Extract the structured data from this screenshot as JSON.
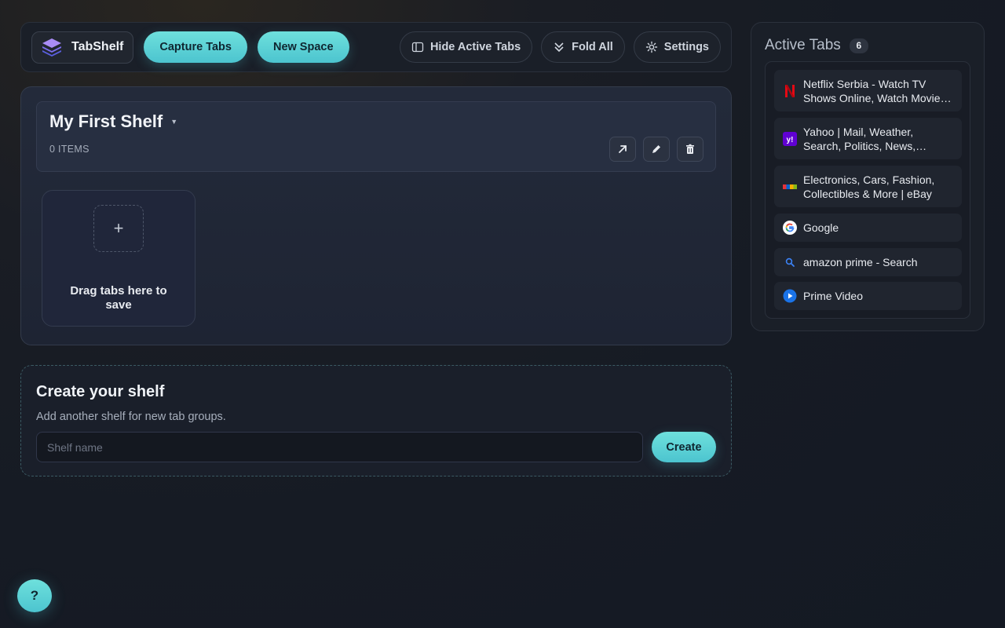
{
  "toolbar": {
    "brand_name": "TabShelf",
    "capture_label": "Capture Tabs",
    "new_space_label": "New Space",
    "hide_active_label": "Hide Active Tabs",
    "fold_all_label": "Fold All",
    "settings_label": "Settings"
  },
  "shelf": {
    "title": "My First Shelf",
    "count_label": "0 ITEMS",
    "drop_plus": "+",
    "drop_text": "Drag tabs here to save"
  },
  "create": {
    "title": "Create your shelf",
    "subtitle": "Add another shelf for new tab groups.",
    "input_value": "",
    "input_placeholder": "Shelf name",
    "button_label": "Create"
  },
  "active_tabs": {
    "title": "Active Tabs",
    "count": "6",
    "items": [
      {
        "title": "Netflix Serbia - Watch TV Shows Online, Watch Movies Online",
        "icon": "netflix-icon"
      },
      {
        "title": "Yahoo | Mail, Weather, Search, Politics, News, Finance, Sports & Videos",
        "icon": "yahoo-icon"
      },
      {
        "title": "Electronics, Cars, Fashion, Collectibles & More | eBay",
        "icon": "ebay-icon"
      },
      {
        "title": "Google",
        "icon": "google-icon"
      },
      {
        "title": "amazon prime - Search",
        "icon": "search-icon"
      },
      {
        "title": "Prime Video",
        "icon": "prime-video-icon"
      }
    ]
  },
  "help_label": "?",
  "colors": {
    "accent": "#4cc4cf",
    "background": "#161b24"
  }
}
